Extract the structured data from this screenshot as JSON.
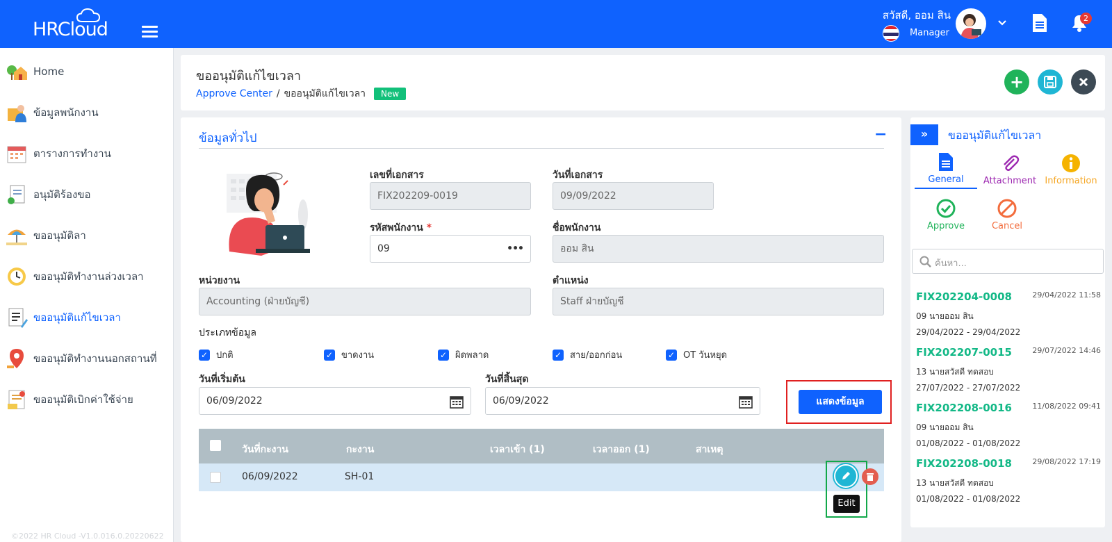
{
  "header": {
    "logo": "HRCloud",
    "greeting": "สวัสดี, ออม สิน",
    "role": "Manager",
    "notification_count": "2"
  },
  "sidebar": {
    "items": [
      {
        "label": "Home",
        "icon": "home-icon"
      },
      {
        "label": "ข้อมูลพนักงาน",
        "icon": "employee-icon"
      },
      {
        "label": "ตารางการทำงาน",
        "icon": "calendar-icon"
      },
      {
        "label": "อนุมัติร้องขอ",
        "icon": "approve-request-icon"
      },
      {
        "label": "ขออนุมัติลา",
        "icon": "leave-icon"
      },
      {
        "label": "ขออนุมัติทำงานล่วงเวลา",
        "icon": "overtime-icon"
      },
      {
        "label": "ขออนุมัติแก้ไขเวลา",
        "icon": "time-edit-icon",
        "active": true
      },
      {
        "label": "ขออนุมัติทำงานนอกสถานที่",
        "icon": "location-icon"
      },
      {
        "label": "ขออนุมัติเบิกค่าใช้จ่าย",
        "icon": "expense-icon"
      }
    ],
    "footer": "©2022 HR Cloud -V1.0.016.0.20220622"
  },
  "page": {
    "title": "ขออนุมัติแก้ไขเวลา",
    "breadcrumb_link": "Approve Center",
    "breadcrumb_sep": "/",
    "breadcrumb_current": "ขออนุมัติแก้ไขเวลา",
    "status_badge": "New"
  },
  "form": {
    "section_title": "ข้อมูลทั่วไป",
    "collapse": "−",
    "doc_no_label": "เลขที่เอกสาร",
    "doc_no": "FIX202209-0019",
    "doc_date_label": "วันที่เอกสาร",
    "doc_date": "09/09/2022",
    "emp_code_label": "รหัสพนักงาน",
    "required_mark": "*",
    "emp_code": "09",
    "lookup": "•••",
    "emp_name_label": "ชื่อพนักงาน",
    "emp_name": "ออม สิน",
    "dept_label": "หน่วยงาน",
    "dept": "Accounting (ฝ่ายบัญชี)",
    "position_label": "ตำแหน่ง",
    "position": "Staff ฝ่ายบัญชี",
    "type_label": "ประเภทข้อมูล",
    "types": [
      "ปกติ",
      "ขาดงาน",
      "ผิดพลาด",
      "สาย/ออกก่อน",
      "OT วันหยุด"
    ],
    "start_label": "วันที่เริ่มต้น",
    "start_date": "06/09/2022",
    "end_label": "วันที่สิ้นสุด",
    "end_date": "06/09/2022",
    "show_button": "แสดงข้อมูล"
  },
  "table": {
    "headers": [
      "วันที่กะงาน",
      "กะงาน",
      "เวลาเข้า (1)",
      "เวลาออก (1)",
      "สาเหตุ"
    ],
    "rows": [
      {
        "date": "06/09/2022",
        "shift": "SH-01",
        "in": "",
        "out": "",
        "reason": ""
      }
    ],
    "edit_tooltip": "Edit"
  },
  "right_panel": {
    "title": "ขออนุมัติแก้ไขเวลา",
    "tools": {
      "general": "General",
      "attachment": "Attachment",
      "information": "Information",
      "approve": "Approve",
      "cancel": "Cancel"
    },
    "search_placeholder": "ค้นหา...",
    "records": [
      {
        "id": "FIX202204-0008",
        "time": "29/04/2022 11:58",
        "name": "09 นายออม สิน",
        "range": "29/04/2022 - 29/04/2022"
      },
      {
        "id": "FIX202207-0015",
        "time": "29/07/2022 14:46",
        "name": "13 นายสวัสดี ทดสอบ",
        "range": "27/07/2022 - 27/07/2022"
      },
      {
        "id": "FIX202208-0016",
        "time": "11/08/2022 09:41",
        "name": "09 นายออม สิน",
        "range": "01/08/2022 - 01/08/2022"
      },
      {
        "id": "FIX202208-0018",
        "time": "29/08/2022 17:19",
        "name": "13 นายสวัสดี ทดสอบ",
        "range": "01/08/2022 - 01/08/2022"
      }
    ]
  },
  "colors": {
    "primary": "#0f62fe",
    "success": "#12b886",
    "highlight_red": "#e02020",
    "highlight_green": "#12a84a"
  }
}
